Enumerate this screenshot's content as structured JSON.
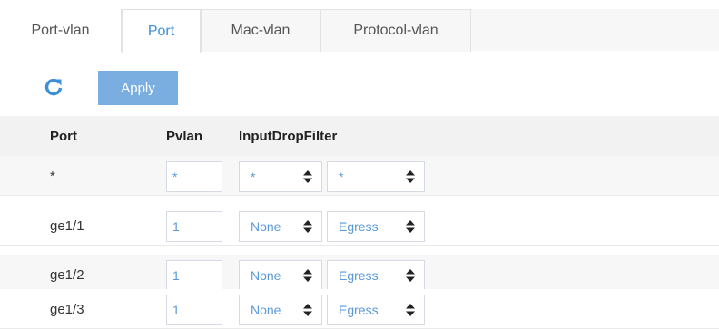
{
  "tabs": [
    {
      "label": "Port-vlan",
      "active": false
    },
    {
      "label": "Port",
      "active": true
    },
    {
      "label": "Mac-vlan",
      "active": false
    },
    {
      "label": "Protocol-vlan",
      "active": false
    }
  ],
  "toolbar": {
    "refresh_icon": "refresh-icon",
    "apply_label": "Apply"
  },
  "table": {
    "columns": [
      "Port",
      "Pvlan",
      "InputDropFilter"
    ],
    "rows": [
      {
        "port": "*",
        "pvlan": "*",
        "filter1": "*",
        "filter2": "*"
      },
      {
        "port": "ge1/1",
        "pvlan": "1",
        "filter1": "None",
        "filter2": "Egress"
      },
      {
        "port": "ge1/2",
        "pvlan": "1",
        "filter1": "None",
        "filter2": "Egress"
      },
      {
        "port": "ge1/3",
        "pvlan": "1",
        "filter1": "None",
        "filter2": "Egress"
      }
    ]
  },
  "colors": {
    "accent": "#3d8fd6",
    "apply_button": "#7aaee0",
    "value_text": "#5a9ad9"
  }
}
